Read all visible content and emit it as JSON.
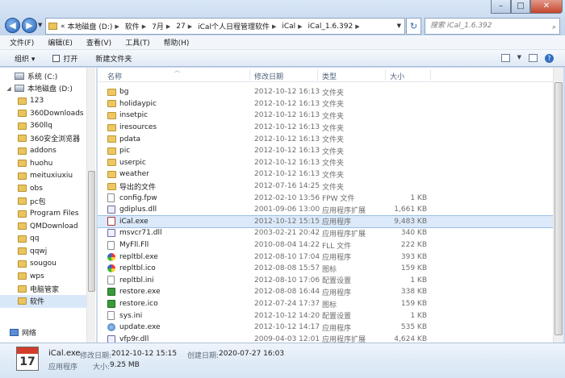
{
  "window": {
    "address": [
      "本地磁盘 (D:)",
      "软件",
      "7月",
      "27",
      "iCal个人日程管理软件",
      "iCal",
      "iCal_1.6.392"
    ],
    "address_prefix": "«",
    "search_placeholder": "搜索 iCal_1.6.392"
  },
  "menu": [
    "文件(F)",
    "编辑(E)",
    "查看(V)",
    "工具(T)",
    "帮助(H)"
  ],
  "toolbar": {
    "organize": "组织 ▾",
    "open": "打开",
    "new_folder": "新建文件夹"
  },
  "nav": {
    "items": [
      {
        "label": "系统 (C:)",
        "kind": "drive",
        "indent": 0
      },
      {
        "label": "本地磁盘 (D:)",
        "kind": "drive",
        "indent": 0
      },
      {
        "label": "123",
        "kind": "folder",
        "indent": 1
      },
      {
        "label": "360Downloads",
        "kind": "folder",
        "indent": 1
      },
      {
        "label": "360llq",
        "kind": "folder",
        "indent": 1
      },
      {
        "label": "360安全浏览器",
        "kind": "folder",
        "indent": 1
      },
      {
        "label": "addons",
        "kind": "folder",
        "indent": 1
      },
      {
        "label": "huohu",
        "kind": "folder",
        "indent": 1
      },
      {
        "label": "meituxiuxiu",
        "kind": "folder",
        "indent": 1
      },
      {
        "label": "obs",
        "kind": "folder",
        "indent": 1
      },
      {
        "label": "pc包",
        "kind": "folder",
        "indent": 1
      },
      {
        "label": "Program Files",
        "kind": "folder",
        "indent": 1
      },
      {
        "label": "QMDownload",
        "kind": "folder",
        "indent": 1
      },
      {
        "label": "qq",
        "kind": "folder",
        "indent": 1
      },
      {
        "label": "qqwj",
        "kind": "folder",
        "indent": 1
      },
      {
        "label": "sougou",
        "kind": "folder",
        "indent": 1
      },
      {
        "label": "wps",
        "kind": "folder",
        "indent": 1
      },
      {
        "label": "电脑管家",
        "kind": "folder",
        "indent": 1
      },
      {
        "label": "软件",
        "kind": "folder",
        "indent": 1,
        "selected": true
      },
      {
        "label": "网络",
        "kind": "network",
        "indent": 0
      }
    ]
  },
  "columns": {
    "name": "名称",
    "date": "修改日期",
    "type": "类型",
    "size": "大小"
  },
  "files": [
    {
      "name": "bg",
      "date": "2012-10-12 16:13",
      "type": "文件夹",
      "size": "",
      "icon": "folder-icon"
    },
    {
      "name": "holidaypic",
      "date": "2012-10-12 16:13",
      "type": "文件夹",
      "size": "",
      "icon": "folder-icon"
    },
    {
      "name": "insetpic",
      "date": "2012-10-12 16:13",
      "type": "文件夹",
      "size": "",
      "icon": "folder-icon"
    },
    {
      "name": "iresources",
      "date": "2012-10-12 16:13",
      "type": "文件夹",
      "size": "",
      "icon": "folder-icon"
    },
    {
      "name": "pdata",
      "date": "2012-10-12 16:13",
      "type": "文件夹",
      "size": "",
      "icon": "folder-icon"
    },
    {
      "name": "pic",
      "date": "2012-10-12 16:13",
      "type": "文件夹",
      "size": "",
      "icon": "folder-icon"
    },
    {
      "name": "userpic",
      "date": "2012-10-12 16:13",
      "type": "文件夹",
      "size": "",
      "icon": "folder-icon"
    },
    {
      "name": "weather",
      "date": "2012-10-12 16:13",
      "type": "文件夹",
      "size": "",
      "icon": "folder-icon"
    },
    {
      "name": "导出的文件",
      "date": "2012-07-16 14:25",
      "type": "文件夹",
      "size": "",
      "icon": "folder-icon"
    },
    {
      "name": "config.fpw",
      "date": "2012-02-10 13:56",
      "type": "FPW 文件",
      "size": "1 KB",
      "icon": "document-icon"
    },
    {
      "name": "gdiplus.dll",
      "date": "2001-09-06 13:00",
      "type": "应用程序扩展",
      "size": "1,661 KB",
      "icon": "dll-icon"
    },
    {
      "name": "iCal.exe",
      "date": "2012-10-12 15:15",
      "type": "应用程序",
      "size": "9,483 KB",
      "icon": "calendar-app-icon",
      "selected": true
    },
    {
      "name": "msvcr71.dll",
      "date": "2003-02-21 20:42",
      "type": "应用程序扩展",
      "size": "340 KB",
      "icon": "dll-icon"
    },
    {
      "name": "MyFll.Fll",
      "date": "2010-08-04 14:22",
      "type": "FLL 文件",
      "size": "222 KB",
      "icon": "document-icon"
    },
    {
      "name": "repltbl.exe",
      "date": "2012-08-10 17:04",
      "type": "应用程序",
      "size": "393 KB",
      "icon": "color-wheel-icon"
    },
    {
      "name": "repltbl.ico",
      "date": "2012-08-08 15:57",
      "type": "图标",
      "size": "159 KB",
      "icon": "color-wheel-icon"
    },
    {
      "name": "repltbl.ini",
      "date": "2012-08-10 17:06",
      "type": "配置设置",
      "size": "1 KB",
      "icon": "document-icon"
    },
    {
      "name": "restore.exe",
      "date": "2012-08-08 16:44",
      "type": "应用程序",
      "size": "338 KB",
      "icon": "green-app-icon"
    },
    {
      "name": "restore.ico",
      "date": "2012-07-24 17:37",
      "type": "图标",
      "size": "159 KB",
      "icon": "green-app-icon"
    },
    {
      "name": "sys.ini",
      "date": "2012-10-12 14:20",
      "type": "配置设置",
      "size": "1 KB",
      "icon": "document-icon"
    },
    {
      "name": "update.exe",
      "date": "2012-10-12 14:17",
      "type": "应用程序",
      "size": "535 KB",
      "icon": "globe-icon"
    },
    {
      "name": "vfp9r.dll",
      "date": "2009-04-03 12:01",
      "type": "应用程序扩展",
      "size": "4,624 KB",
      "icon": "dll-icon"
    }
  ],
  "details": {
    "icon_day": "17",
    "name": "iCal.exe",
    "type": "应用程序",
    "modified_label": "修改日期:",
    "modified": "2012-10-12 15:15",
    "created_label": "创建日期:",
    "created": "2020-07-27 16:03",
    "size_label": "大小:",
    "size": "9.25 MB"
  }
}
